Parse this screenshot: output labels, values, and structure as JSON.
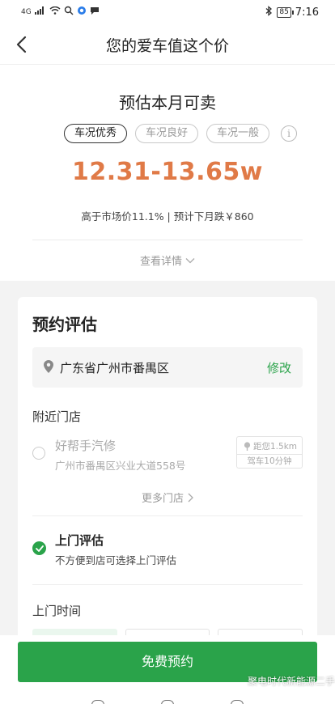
{
  "status_bar": {
    "signal_text": "4G",
    "battery": "85",
    "time": "7:16"
  },
  "header": {
    "title": "您的爱车值这个价"
  },
  "estimate": {
    "title": "预估本月可卖",
    "conditions": [
      "车况优秀",
      "车况良好",
      "车况一般"
    ],
    "selected_condition": "车况优秀",
    "info_icon_glyph": "i",
    "price_range": "12.31-13.65w",
    "price_sub": "高于市场价11.1% | 预计下月跌￥860",
    "details_link": "查看详情",
    "price_color": "#e07a47"
  },
  "booking": {
    "title": "预约评估",
    "location": "广东省广州市番禺区",
    "edit_label": "修改",
    "nearby_label": "附近门店",
    "store": {
      "name": "好帮手汽修",
      "address": "广州市番禺区兴业大道558号",
      "distance": "距您1.5km",
      "drive_time": "驾车10分钟"
    },
    "more_stores": "更多门店",
    "home_service": {
      "title": "上门评估",
      "subtitle": "不方便到店可选择上门评估",
      "checked": true
    },
    "visit_time_label": "上门时间"
  },
  "cta": {
    "label": "免费预约"
  },
  "watermark": "聚电时代新能源二手",
  "colors": {
    "accent_green": "#2aa34a",
    "price_orange": "#e07a47"
  }
}
